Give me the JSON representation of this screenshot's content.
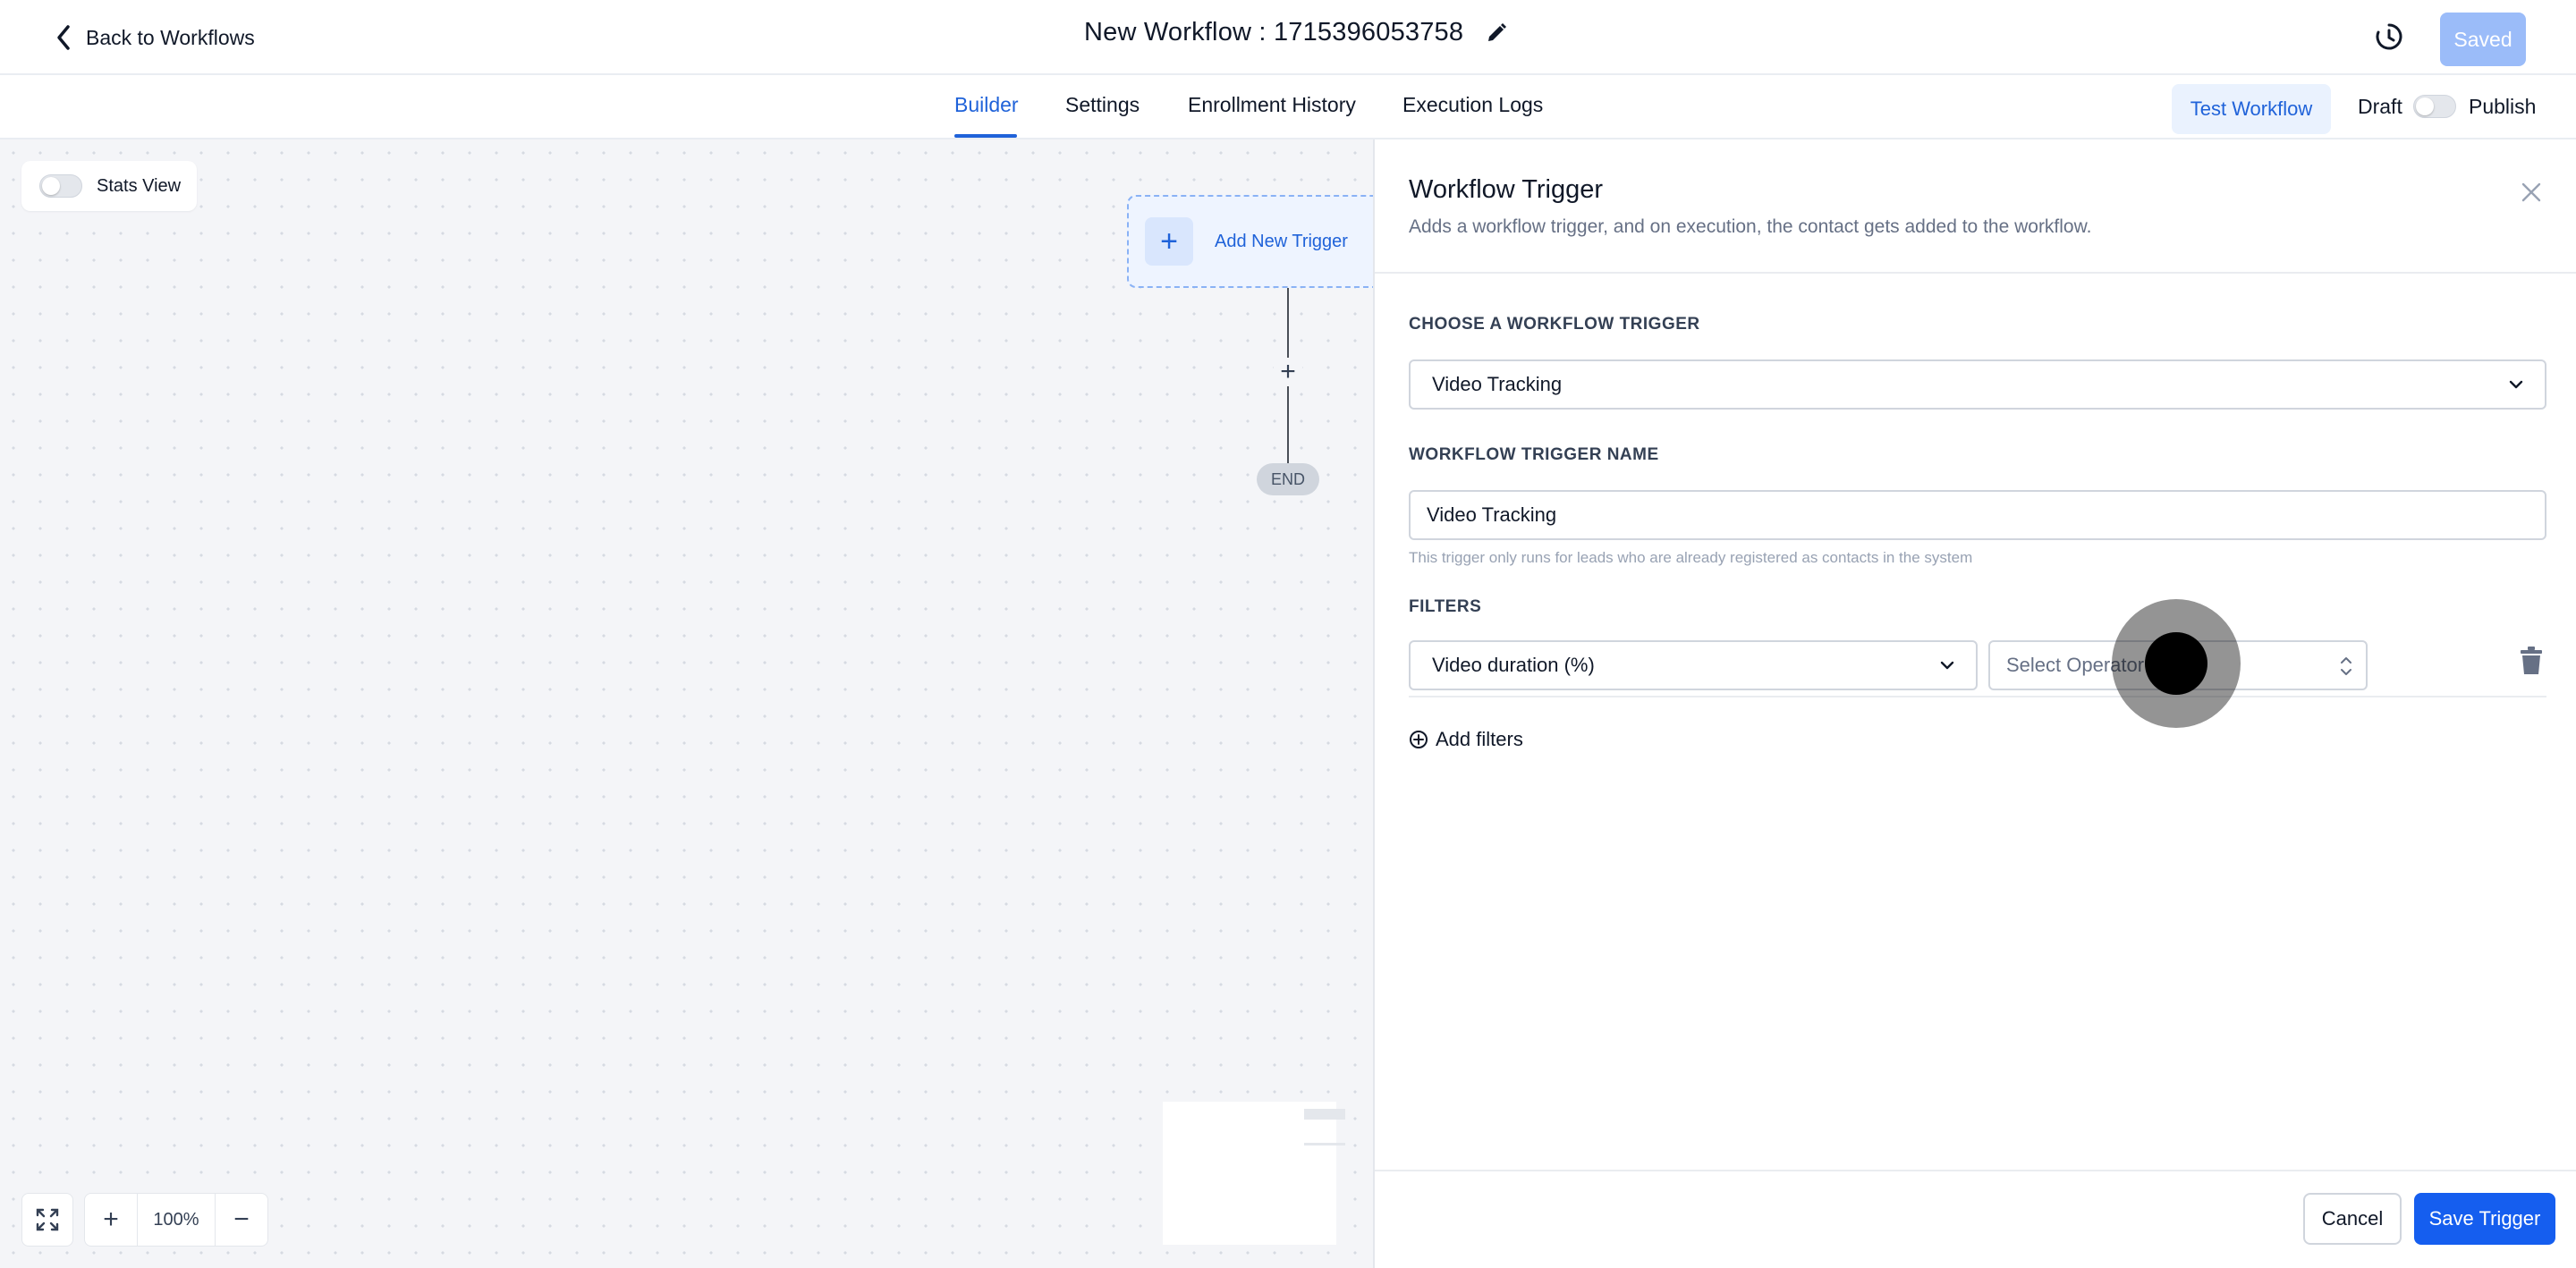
{
  "header": {
    "back_label": "Back to Workflows",
    "title": "New Workflow : 1715396053758",
    "saved_label": "Saved"
  },
  "tabs": {
    "items": [
      {
        "label": "Builder",
        "active": true
      },
      {
        "label": "Settings",
        "active": false
      },
      {
        "label": "Enrollment History",
        "active": false
      },
      {
        "label": "Execution Logs",
        "active": false
      }
    ],
    "test_workflow_label": "Test Workflow",
    "draft_label": "Draft",
    "publish_label": "Publish",
    "publish_toggle_on": false
  },
  "canvas": {
    "stats_view_label": "Stats View",
    "stats_view_on": false,
    "add_trigger_label": "Add New Trigger",
    "end_label": "END",
    "zoom_level": "100%"
  },
  "panel": {
    "title": "Workflow Trigger",
    "description": "Adds a workflow trigger, and on execution, the contact gets added to the workflow.",
    "choose_trigger_label": "CHOOSE A WORKFLOW TRIGGER",
    "selected_trigger": "Video Tracking",
    "trigger_name_label": "WORKFLOW TRIGGER NAME",
    "trigger_name_value": "Video Tracking",
    "trigger_hint": "This trigger only runs for leads who are already registered as contacts in the system",
    "filters_label": "FILTERS",
    "filter_field_value": "Video duration (%)",
    "operator_placeholder": "Select Operator",
    "add_filters_label": "Add filters",
    "cancel_label": "Cancel",
    "save_label": "Save Trigger"
  },
  "colors": {
    "accent": "#1f62d9",
    "primary_button": "#155eef",
    "saved_button": "#9bbcf9"
  }
}
